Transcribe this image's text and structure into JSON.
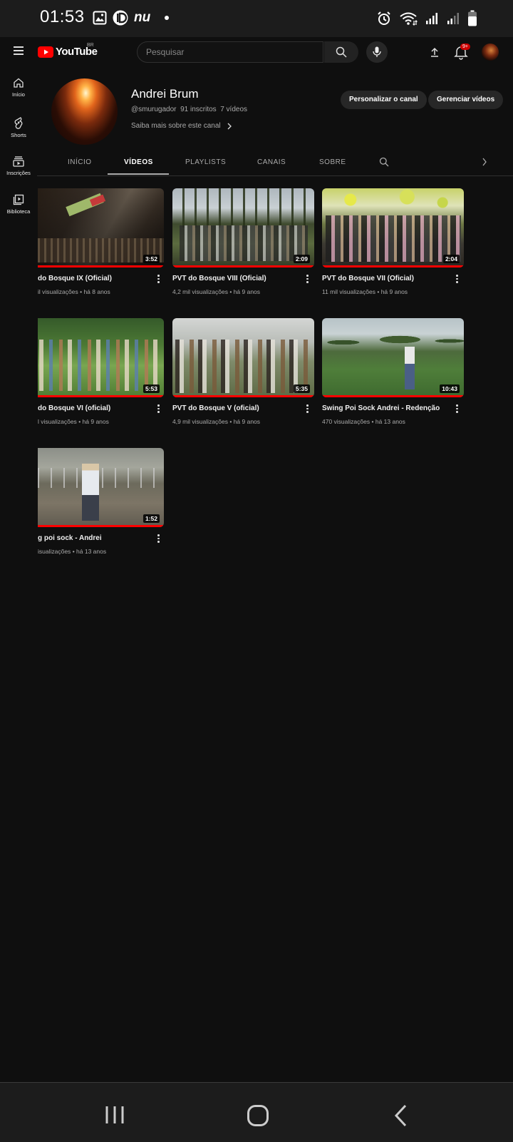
{
  "status_bar": {
    "time": "01:53",
    "notification_icons": [
      "gallery-icon",
      "identity-app-icon",
      "nubank-icon"
    ],
    "nubank_text": "nu",
    "system_icons": [
      "alarm-icon",
      "wifi-icon",
      "signal-icon",
      "signal-icon-2",
      "battery-icon"
    ]
  },
  "header": {
    "logo_text": "YouTube",
    "logo_region": "BR",
    "search_placeholder": "Pesquisar",
    "notification_badge": "9+",
    "accent_color": "#ff0000"
  },
  "sidebar": {
    "items": [
      {
        "label": "Início",
        "icon": "home-icon"
      },
      {
        "label": "Shorts",
        "icon": "shorts-icon"
      },
      {
        "label": "Inscrições",
        "icon": "subscriptions-icon"
      },
      {
        "label": "Biblioteca",
        "icon": "library-icon"
      }
    ]
  },
  "channel": {
    "name": "Andrei Brum",
    "handle": "@smurugador",
    "subscribers": "91 inscritos",
    "videos_count": "7 vídeos",
    "more_about": "Saiba mais sobre este canal",
    "customize_label": "Personalizar o canal",
    "manage_label": "Gerenciar vídeos"
  },
  "tabs": [
    {
      "label": "INÍCIO",
      "active": false
    },
    {
      "label": "VÍDEOS",
      "active": true
    },
    {
      "label": "PLAYLISTS",
      "active": false
    },
    {
      "label": "CANAIS",
      "active": false
    },
    {
      "label": "SOBRE",
      "active": false
    }
  ],
  "videos": [
    {
      "title": "do Bosque IX (Oficial)",
      "duration": "3:52",
      "views": "il visualizações",
      "age": "há 8 anos",
      "watched": 1.0
    },
    {
      "title": "PVT do Bosque VIII (Oficial)",
      "duration": "2:09",
      "views": "4,2 mil visualizações",
      "age": "há 9 anos",
      "watched": 1.0
    },
    {
      "title": "PVT do Bosque VII (Oficial)",
      "duration": "2:04",
      "views": "11 mil visualizações",
      "age": "há 9 anos",
      "watched": 1.0
    },
    {
      "title": "do Bosque VI (oficial)",
      "duration": "5:53",
      "views": "l visualizações",
      "age": "há 9 anos",
      "watched": 1.0
    },
    {
      "title": "PVT do Bosque V (oficial)",
      "duration": "5:35",
      "views": "4,9 mil visualizações",
      "age": "há 9 anos",
      "watched": 1.0
    },
    {
      "title": "Swing Poi Sock Andrei - Redenção",
      "duration": "10:43",
      "views": "470 visualizações",
      "age": "há 13 anos",
      "watched": 1.0
    },
    {
      "title": "g poi sock - Andrei",
      "duration": "1:52",
      "views": "isualizações",
      "age": "há 13 anos",
      "watched": 1.0
    }
  ],
  "meta_separator": "•"
}
